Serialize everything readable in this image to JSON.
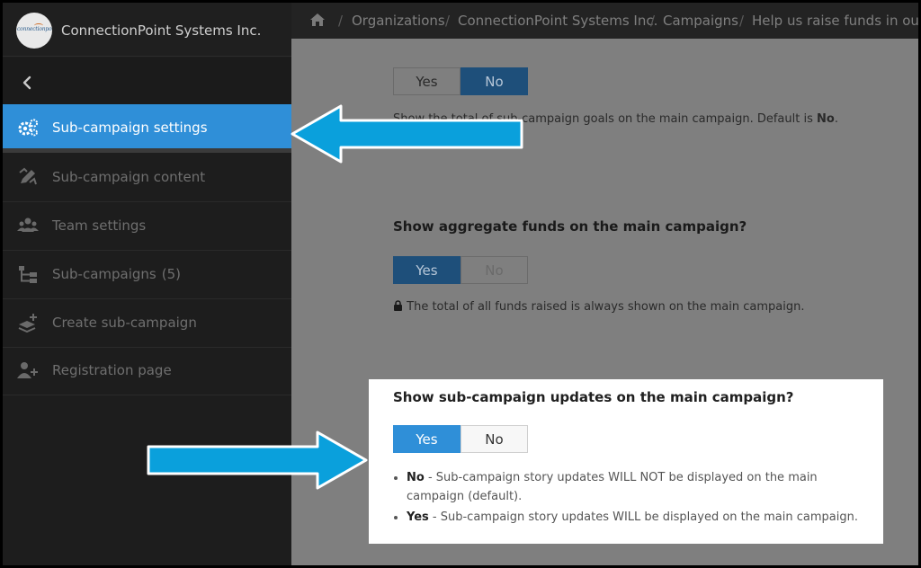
{
  "org": {
    "name": "ConnectionPoint Systems Inc.",
    "logo_text": "connectionpoint"
  },
  "breadcrumbs": [
    "Organizations",
    "ConnectionPoint Systems Inc.",
    "Campaigns",
    "Help us raise funds in our P"
  ],
  "sidebar": {
    "items": [
      {
        "label": "Sub-campaign settings",
        "icon": "gears-icon",
        "active": true
      },
      {
        "label": "Sub-campaign content",
        "icon": "pencil-icon"
      },
      {
        "label": "Team settings",
        "icon": "users-icon"
      },
      {
        "label": "Sub-campaigns",
        "count": "(5)",
        "icon": "sitemap-icon"
      },
      {
        "label": "Create sub-campaign",
        "icon": "layers-plus-icon"
      },
      {
        "label": "Registration page",
        "icon": "user-plus-icon"
      }
    ]
  },
  "main": {
    "goals_toggle": {
      "yes": "Yes",
      "no": "No",
      "selected": "No"
    },
    "goals_help": {
      "prefix": "Show the total of sub-campaign goals on the main campaign. Default is ",
      "emphasis": "No",
      "suffix": "."
    },
    "funds": {
      "title": "Show aggregate funds on the main campaign?",
      "yes": "Yes",
      "no": "No",
      "selected": "Yes",
      "help": "The total of all funds raised is always shown on the main campaign."
    },
    "updates": {
      "title": "Show sub-campaign updates on the main campaign?",
      "yes": "Yes",
      "no": "No",
      "selected": "Yes",
      "bullets": [
        {
          "key": "No",
          "text": " - Sub-campaign story updates WILL NOT be displayed on the main campaign (default)."
        },
        {
          "key": "Yes",
          "text": " - Sub-campaign story updates WILL be displayed on the main campaign."
        }
      ]
    }
  },
  "colors": {
    "accent": "#2f8fd8",
    "arrow": "#0aa0dc",
    "sidebar_bg": "#1d1d1d"
  }
}
